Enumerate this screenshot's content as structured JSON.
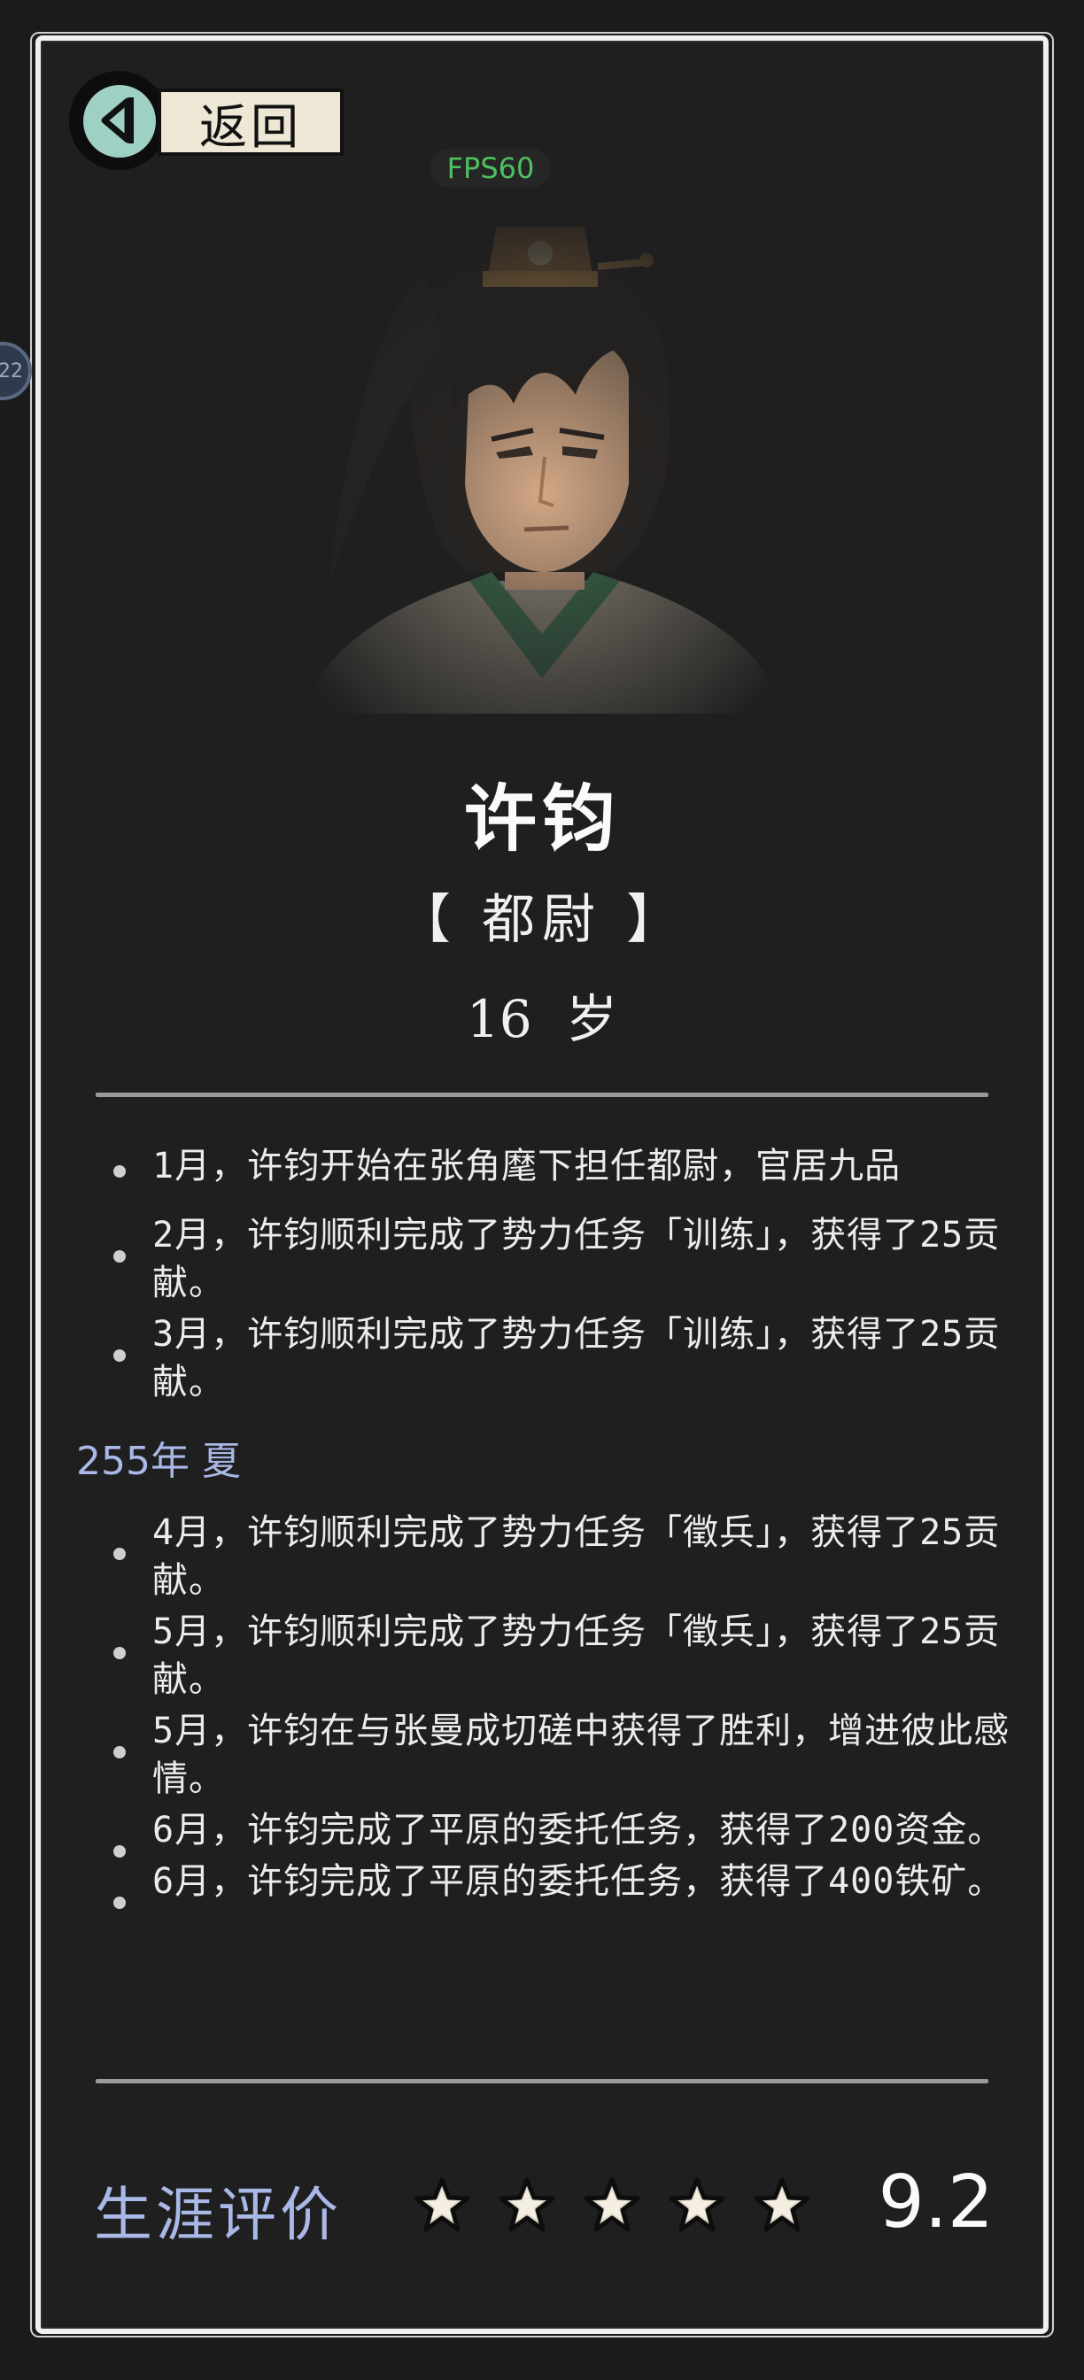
{
  "header": {
    "back_label": "返回",
    "fps": "FPS60",
    "side_badge": "22"
  },
  "character": {
    "name": "许钧",
    "rank": "【 都尉 】",
    "age": "16 岁"
  },
  "log": {
    "entries": [
      {
        "type": "item",
        "text": "1月，许钧开始在张角麾下担任都尉，官居九品"
      },
      {
        "type": "item",
        "text": "2月，许钧顺利完成了势力任务「训练」，获得了25贡献。"
      },
      {
        "type": "item",
        "text": "3月，许钧顺利完成了势力任务「训练」，获得了25贡献。"
      },
      {
        "type": "season",
        "text": "255年 夏"
      },
      {
        "type": "item",
        "text": "4月，许钧顺利完成了势力任务「徵兵」，获得了25贡献。"
      },
      {
        "type": "item",
        "text": "5月，许钧顺利完成了势力任务「徵兵」，获得了25贡献。"
      },
      {
        "type": "item",
        "text": "5月，许钧在与张曼成切磋中获得了胜利，增进彼此感情。"
      },
      {
        "type": "item",
        "text": "6月，许钧完成了平原的委托任务，获得了200资金。"
      },
      {
        "type": "item",
        "text": "6月，许钧完成了平原的委托任务，获得了400铁矿。"
      }
    ]
  },
  "footer": {
    "career_label": "生涯评价",
    "stars_rating": 5,
    "score": "9.2"
  },
  "colors": {
    "background": "#1f1f1f",
    "accent_blue": "#aab8e8",
    "fps_green": "#4fc060",
    "back_teal": "#9fd0c4"
  }
}
